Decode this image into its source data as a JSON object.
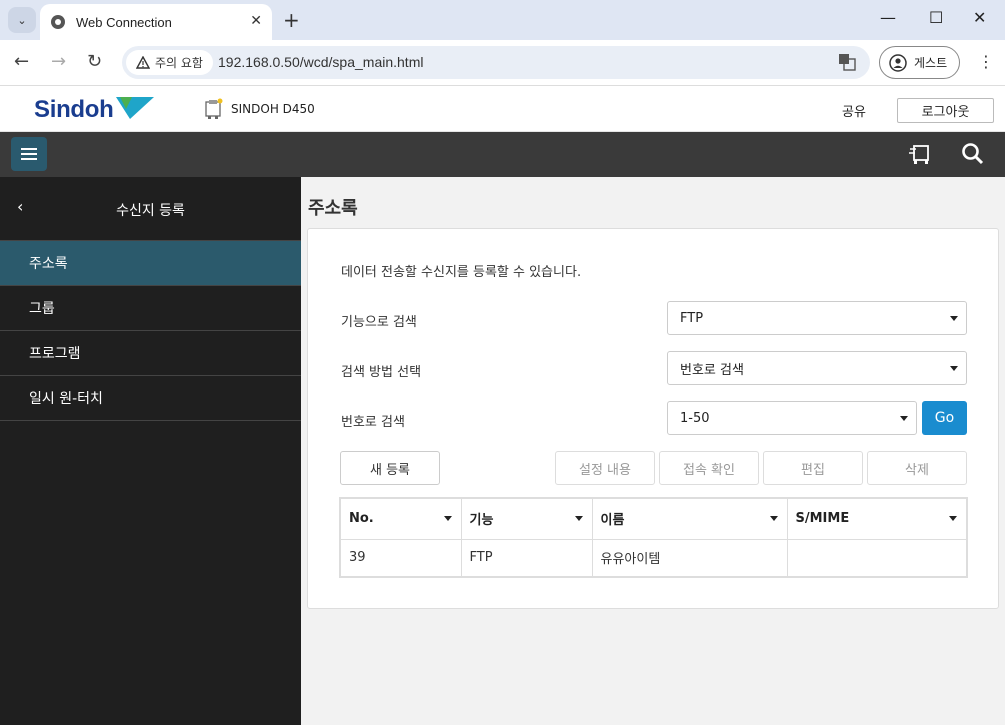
{
  "browser": {
    "tab_title": "Web Connection",
    "security_chip": "주의 요함",
    "url": "192.168.0.50/wcd/spa_main.html",
    "profile_label": "게스트"
  },
  "header": {
    "brand": "Sindoh",
    "device_name": "SINDOH D450",
    "share_label": "공유",
    "logout_label": "로그아웃"
  },
  "sidebar": {
    "title": "수신지 등록",
    "items": [
      {
        "label": "주소록",
        "active": true
      },
      {
        "label": "그룹",
        "active": false
      },
      {
        "label": "프로그램",
        "active": false
      },
      {
        "label": "일시 원-터치",
        "active": false
      }
    ]
  },
  "main": {
    "page_title": "주소록",
    "description": "데이터 전송할 수신지를 등록할 수 있습니다.",
    "filters": [
      {
        "label": "기능으로 검색",
        "value": "FTP"
      },
      {
        "label": "검색 방법 선택",
        "value": "번호로 검색"
      },
      {
        "label": "번호로 검색",
        "value": "1-50"
      }
    ],
    "go_label": "Go",
    "buttons": {
      "new": "새 등록",
      "settings": "설정 내용",
      "connection": "접속 확인",
      "edit": "편집",
      "delete": "삭제"
    },
    "table": {
      "columns": [
        "No.",
        "기능",
        "이름",
        "S/MIME"
      ],
      "rows": [
        [
          "39",
          "FTP",
          "유유아이템",
          ""
        ]
      ]
    }
  },
  "colors": {
    "accent": "#1a8ccf",
    "sidebar_bg": "#1f1f1f",
    "sidebar_active": "#2b5a6c",
    "toolbar_bg": "#3a3a3a",
    "brand_blue": "#1a3d8f"
  }
}
